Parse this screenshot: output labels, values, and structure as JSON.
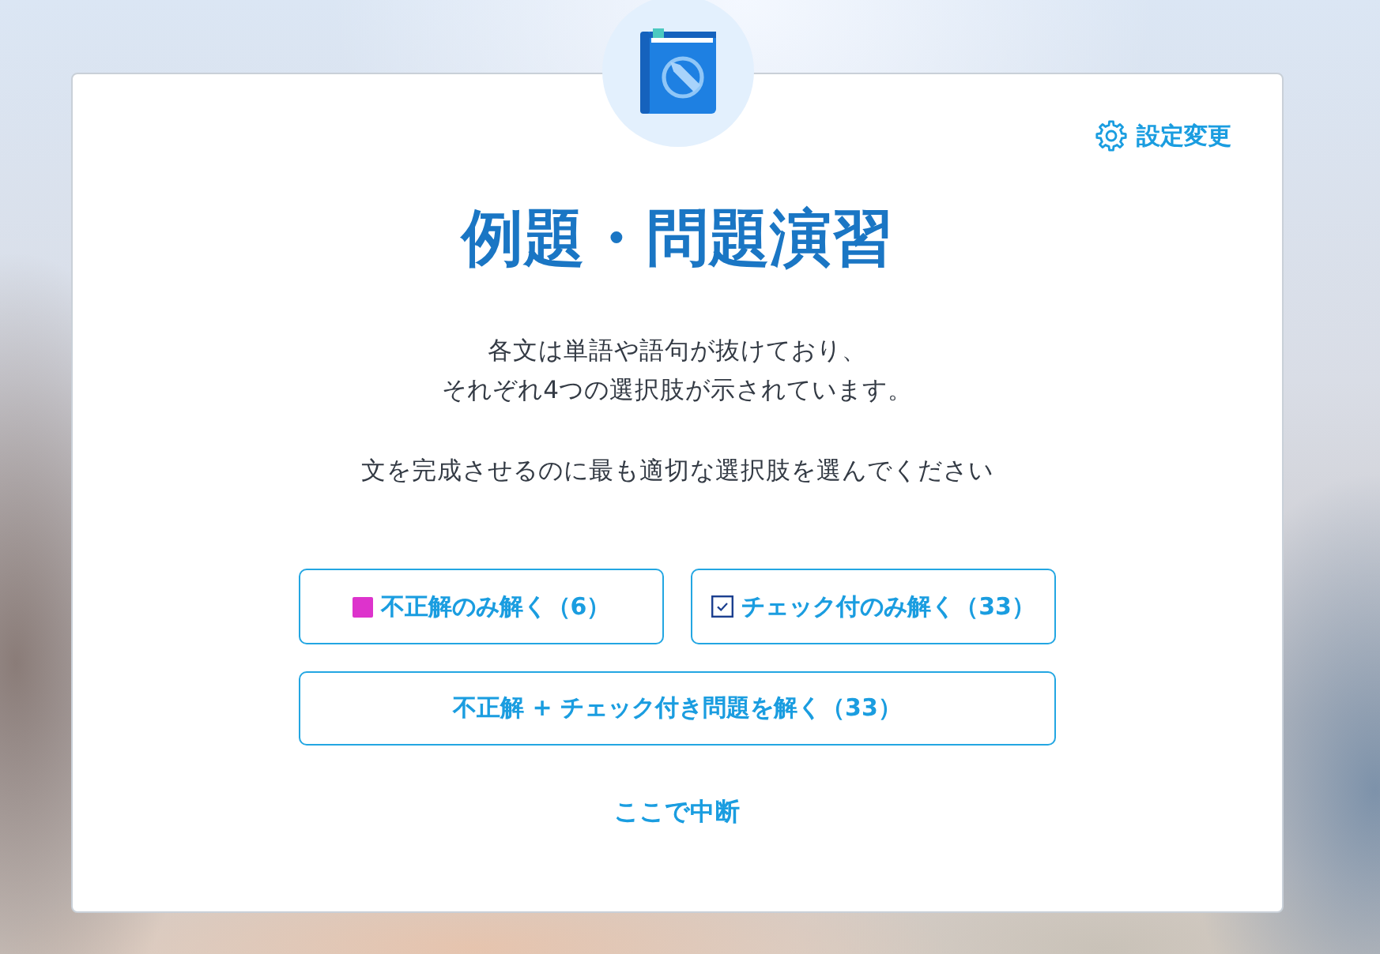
{
  "settings_link": {
    "label": "設定変更"
  },
  "title": "例題・問題演習",
  "instructions": [
    {
      "lines": [
        "各文は単語や語句が抜けており、",
        "それぞれ4つの選択肢が示されています。"
      ]
    },
    {
      "lines": [
        "文を完成させるのに最も適切な選択肢を選んでください"
      ]
    }
  ],
  "buttons": [
    {
      "kind": "incorrect",
      "label": "不正解のみ解く（6）"
    },
    {
      "kind": "checked",
      "label": "チェック付のみ解く（33）"
    },
    {
      "kind": "combined",
      "label": "不正解 + チェック付き問題を解く（33）"
    }
  ],
  "quit_link": {
    "label": "ここで中断"
  }
}
